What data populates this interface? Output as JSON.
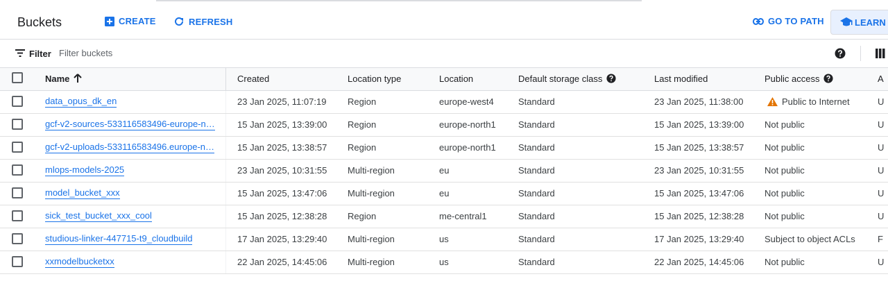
{
  "header": {
    "title": "Buckets",
    "create_label": "CREATE",
    "refresh_label": "REFRESH",
    "go_to_path_label": "GO TO PATH",
    "learn_label": "LEARN"
  },
  "filter": {
    "label": "Filter",
    "placeholder": "Filter buckets"
  },
  "table": {
    "columns": {
      "name": "Name",
      "created": "Created",
      "location_type": "Location type",
      "location": "Location",
      "default_storage_class": "Default storage class",
      "last_modified": "Last modified",
      "public_access": "Public access",
      "access_control": "A"
    },
    "rows": [
      {
        "name": "data_opus_dk_en",
        "created": "23 Jan 2025, 11:07:19",
        "location_type": "Region",
        "location": "europe-west4",
        "storage_class": "Standard",
        "last_modified": "23 Jan 2025, 11:38:00",
        "public_access": "Public to Internet",
        "access_control": "U",
        "warning": true
      },
      {
        "name": "gcf-v2-sources-533116583496-europe-n…",
        "created": "15 Jan 2025, 13:39:00",
        "location_type": "Region",
        "location": "europe-north1",
        "storage_class": "Standard",
        "last_modified": "15 Jan 2025, 13:39:00",
        "public_access": "Not public",
        "access_control": "U"
      },
      {
        "name": "gcf-v2-uploads-533116583496.europe-n…",
        "created": "15 Jan 2025, 13:38:57",
        "location_type": "Region",
        "location": "europe-north1",
        "storage_class": "Standard",
        "last_modified": "15 Jan 2025, 13:38:57",
        "public_access": "Not public",
        "access_control": "U"
      },
      {
        "name": "mlops-models-2025",
        "created": "23 Jan 2025, 10:31:55",
        "location_type": "Multi-region",
        "location": "eu",
        "storage_class": "Standard",
        "last_modified": "23 Jan 2025, 10:31:55",
        "public_access": "Not public",
        "access_control": "U"
      },
      {
        "name": "model_bucket_xxx",
        "created": "15 Jan 2025, 13:47:06",
        "location_type": "Multi-region",
        "location": "eu",
        "storage_class": "Standard",
        "last_modified": "15 Jan 2025, 13:47:06",
        "public_access": "Not public",
        "access_control": "U"
      },
      {
        "name": "sick_test_bucket_xxx_cool",
        "created": "15 Jan 2025, 12:38:28",
        "location_type": "Region",
        "location": "me-central1",
        "storage_class": "Standard",
        "last_modified": "15 Jan 2025, 12:38:28",
        "public_access": "Not public",
        "access_control": "U"
      },
      {
        "name": "studious-linker-447715-t9_cloudbuild",
        "created": "17 Jan 2025, 13:29:40",
        "location_type": "Multi-region",
        "location": "us",
        "storage_class": "Standard",
        "last_modified": "17 Jan 2025, 13:29:40",
        "public_access": "Subject to object ACLs",
        "access_control": "F"
      },
      {
        "name": "xxmodelbucketxx",
        "created": "22 Jan 2025, 14:45:06",
        "location_type": "Multi-region",
        "location": "us",
        "storage_class": "Standard",
        "last_modified": "22 Jan 2025, 14:45:06",
        "public_access": "Not public",
        "access_control": "U"
      }
    ]
  },
  "icons": {
    "create": "add-box-icon",
    "refresh": "refresh-icon",
    "go_to_path": "link-icon",
    "learn": "school-icon",
    "filter": "filter-icon",
    "help": "help-icon",
    "columns": "column-display-icon",
    "sort": "arrow-up-icon",
    "warning": "warning-icon"
  },
  "colors": {
    "accent": "#1a73e8",
    "warning": "#e37400",
    "border": "#dadce0",
    "header_bg": "#f8f9fa"
  }
}
